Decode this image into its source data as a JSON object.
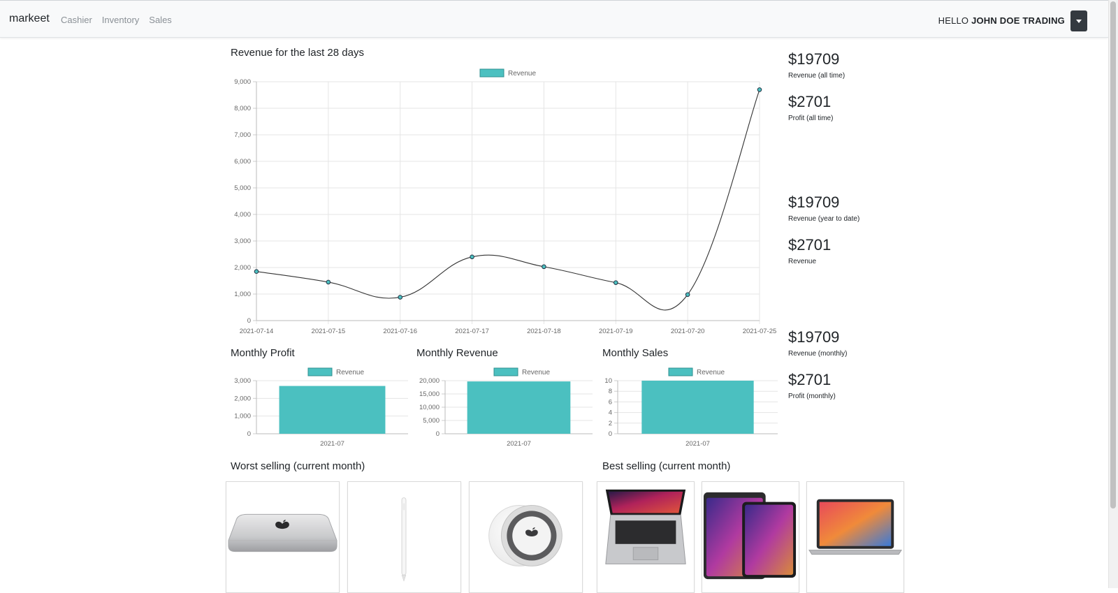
{
  "navbar": {
    "brand": "markeet",
    "links": [
      "Cashier",
      "Inventory",
      "Sales"
    ],
    "greeting": "HELLO",
    "user": "JOHN DOE TRADING"
  },
  "main_chart": {
    "title": "Revenue for the last 28 days",
    "legend": "Revenue"
  },
  "stats": [
    {
      "value": "$19709",
      "label": "Revenue (all time)"
    },
    {
      "value": "$2701",
      "label": "Profit (all time)"
    },
    {
      "value": "$19709",
      "label": "Revenue (year to date)"
    },
    {
      "value": "$2701",
      "label": "Revenue"
    },
    {
      "value": "$19709",
      "label": "Revenue (monthly)"
    },
    {
      "value": "$2701",
      "label": "Profit (monthly)"
    }
  ],
  "small_charts": [
    {
      "title": "Monthly Profit",
      "legend": "Revenue"
    },
    {
      "title": "Monthly Revenue",
      "legend": "Revenue"
    },
    {
      "title": "Monthly Sales",
      "legend": "Revenue"
    }
  ],
  "worst_selling": {
    "title": "Worst selling (current month)",
    "products": [
      "mac-mini",
      "apple-pencil",
      "airtag"
    ]
  },
  "best_selling": {
    "title": "Best selling (current month)",
    "products": [
      "macbook-pro",
      "ipad-pro",
      "macbook-air"
    ]
  },
  "colors": {
    "series_fill": "#4bc0c0",
    "line": "#333333",
    "grid": "#e5e5e5"
  },
  "chart_data": [
    {
      "type": "line",
      "title": "Revenue for the last 28 days",
      "x": [
        "2021-07-14",
        "2021-07-15",
        "2021-07-16",
        "2021-07-17",
        "2021-07-18",
        "2021-07-19",
        "2021-07-20",
        "2021-07-25"
      ],
      "series": [
        {
          "name": "Revenue",
          "values": [
            1850,
            1450,
            880,
            2400,
            2030,
            1430,
            980,
            8700
          ]
        }
      ],
      "yticks": [
        "0",
        "1,000",
        "2,000",
        "3,000",
        "4,000",
        "5,000",
        "6,000",
        "7,000",
        "8,000",
        "9,000"
      ],
      "ylim": [
        0,
        9000
      ],
      "legend": "top"
    },
    {
      "type": "bar",
      "title": "Monthly Profit",
      "categories": [
        "2021-07"
      ],
      "series": [
        {
          "name": "Revenue",
          "values": [
            2701
          ]
        }
      ],
      "yticks": [
        "0",
        "1,000",
        "2,000",
        "3,000"
      ],
      "ylim": [
        0,
        3000
      ],
      "legend": "top"
    },
    {
      "type": "bar",
      "title": "Monthly Revenue",
      "categories": [
        "2021-07"
      ],
      "series": [
        {
          "name": "Revenue",
          "values": [
            19709
          ]
        }
      ],
      "yticks": [
        "0",
        "5,000",
        "10,000",
        "15,000",
        "20,000"
      ],
      "ylim": [
        0,
        20000
      ],
      "legend": "top"
    },
    {
      "type": "bar",
      "title": "Monthly Sales",
      "categories": [
        "2021-07"
      ],
      "series": [
        {
          "name": "Revenue",
          "values": [
            10
          ]
        }
      ],
      "yticks": [
        "0",
        "2",
        "4",
        "6",
        "8",
        "10"
      ],
      "ylim": [
        0,
        10
      ],
      "legend": "top"
    }
  ]
}
